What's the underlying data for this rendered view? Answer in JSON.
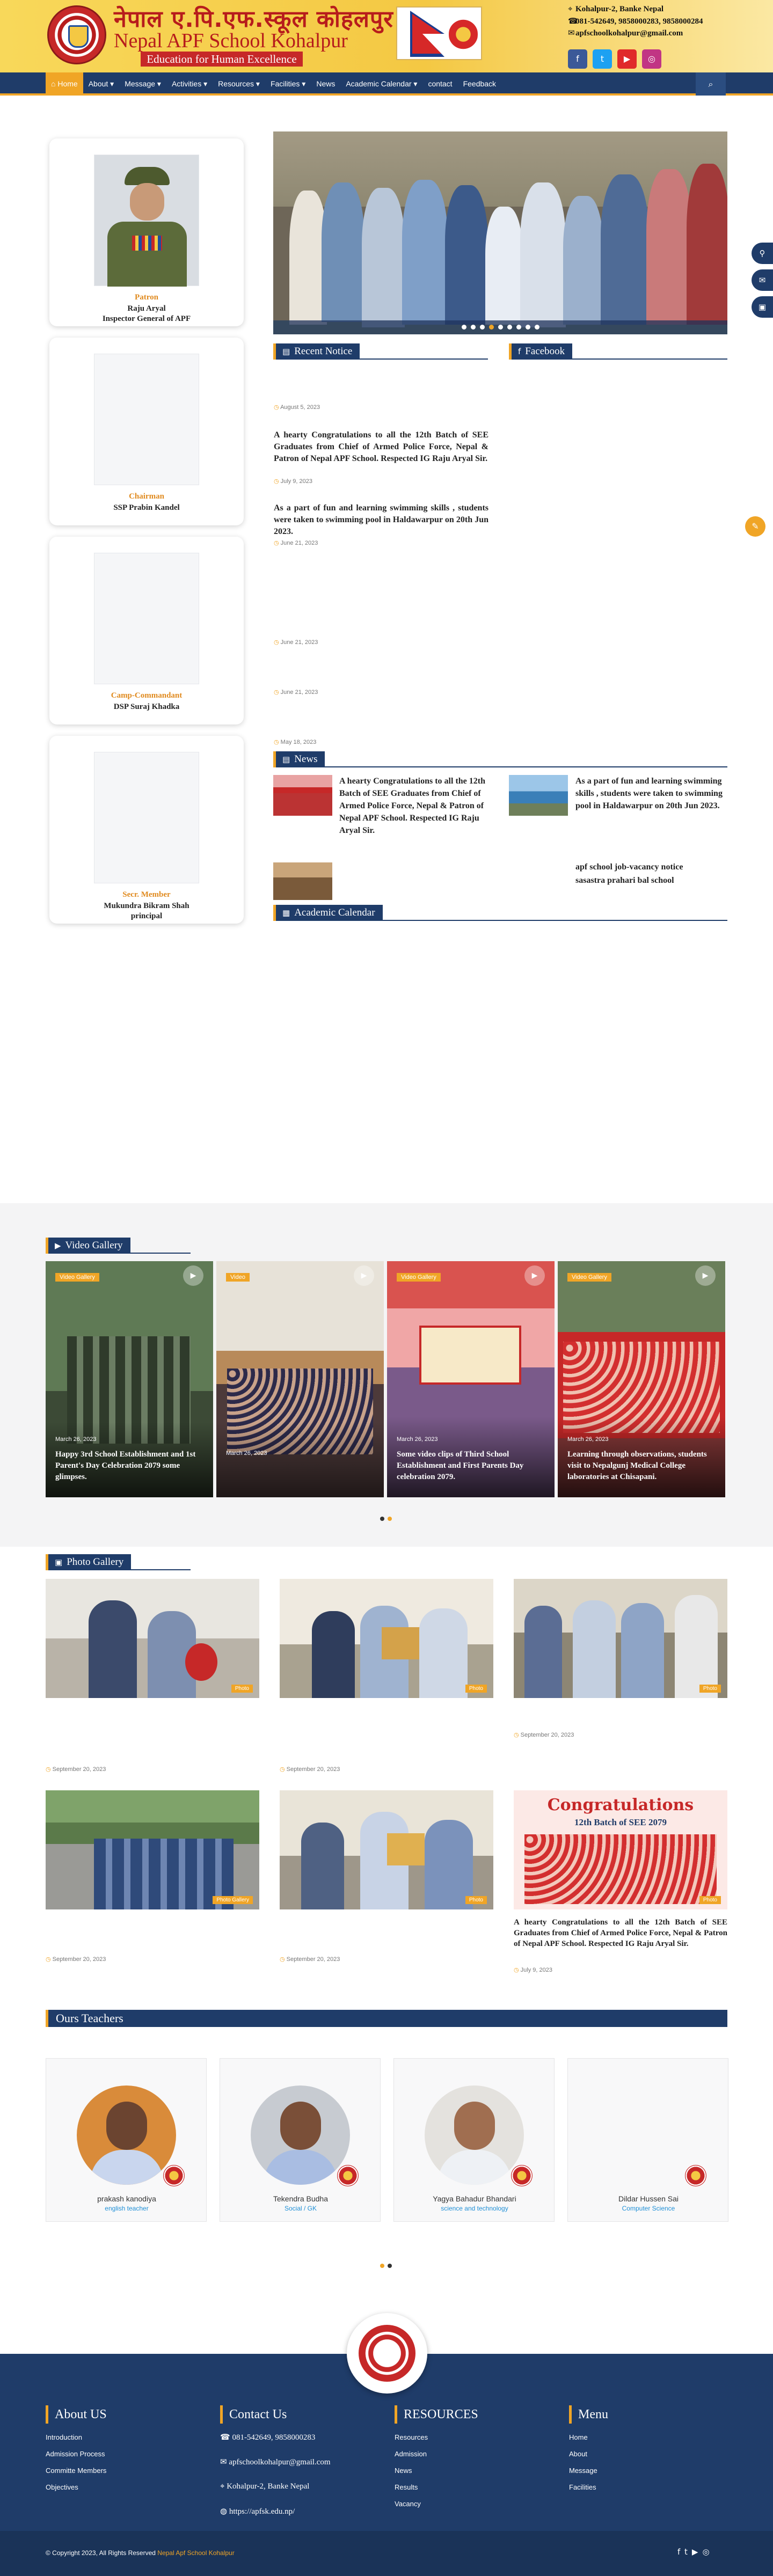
{
  "header": {
    "title_nepali": "नेपाल ए.पि.एफ.स्कूल कोहलपुर",
    "title_english": "Nepal APF School Kohalpur",
    "tagline": "Education for Human Excellence",
    "address": "Kohalpur-2, Banke Nepal",
    "phones": "081-542649, 9858000283, 9858000284",
    "email": "apfschoolkohalpur@gmail.com",
    "social": [
      "facebook-icon",
      "twitter-icon",
      "youtube-icon",
      "instagram-icon"
    ],
    "social_colors": [
      "#3b5998",
      "#1da1f2",
      "#e02a2a",
      "#c13584"
    ],
    "social_glyphs": [
      "f",
      "t",
      "▶",
      "◎"
    ]
  },
  "nav": {
    "items": [
      "⌂ Home",
      "About ▾",
      "Message ▾",
      "Activities ▾",
      "Resources ▾",
      "Facilities ▾",
      "News",
      "Academic Calendar ▾",
      "contact",
      "Feedback"
    ],
    "search_icon": "⌕"
  },
  "profiles": [
    {
      "rank": "Patron",
      "name": "Raju Aryal",
      "title": "Inspector General of APF"
    },
    {
      "rank": "Chairman",
      "name": "SSP Prabin Kandel",
      "title": ""
    },
    {
      "rank": "Camp-Commandant",
      "name": "DSP Suraj Khadka",
      "title": ""
    },
    {
      "rank": "Secr. Member",
      "name": "Mukundra Bikram Shah",
      "title": "principal"
    }
  ],
  "notice": {
    "heading": "Recent Notice",
    "facebook_heading": "Facebook",
    "items": [
      {
        "date": "August 5, 2023",
        "text": ""
      },
      {
        "date": "July 9, 2023",
        "text": "A hearty Congratulations to all the 12th Batch of SEE Graduates from Chief of Armed Police Force, Nepal & Patron of Nepal APF School. Respected IG Raju Aryal Sir."
      },
      {
        "date": "June 21, 2023",
        "text": "As a part of fun and learning swimming skills , students were taken to swimming pool in Haldawarpur on 20th Jun 2023."
      },
      {
        "date": "June 21, 2023",
        "text": ""
      },
      {
        "date": "June 21, 2023",
        "text": ""
      },
      {
        "date": "May 18, 2023",
        "text": ""
      }
    ]
  },
  "news": {
    "heading": "News",
    "items": [
      {
        "text": "A hearty Congratulations to all the 12th Batch of SEE Graduates from Chief of Armed Police Force, Nepal & Patron of Nepal APF School. Respected IG Raju Aryal Sir."
      },
      {
        "text": "As a part of fun and learning swimming skills , students were taken to swimming pool in Haldawarpur on 20th Jun 2023."
      },
      {
        "text": "apf school job-vacancy notice"
      },
      {
        "text": "sasastra prahari bal school"
      }
    ]
  },
  "calendar": {
    "heading": "Academic Calendar"
  },
  "video_gallery": {
    "heading": "Video Gallery",
    "items": [
      {
        "badge": "Video Gallery",
        "date": "March 26, 2023",
        "title": "Happy 3rd School Establishment and 1st Parent's Day Celebration 2079 some glimpses."
      },
      {
        "badge": "Video",
        "date": "March 26, 2023",
        "title": ""
      },
      {
        "badge": "Video Gallery",
        "date": "March 26, 2023",
        "title": "Some video clips of Third School Establishment and First Parents Day celebration 2079."
      },
      {
        "badge": "Video Gallery",
        "date": "March 26, 2023",
        "title": "Learning through observations, students visit to Nepalgunj Medical College laboratories at Chisapani."
      }
    ]
  },
  "photo_gallery": {
    "heading": "Photo Gallery",
    "items": [
      {
        "badge": "Photo",
        "date": "September 20, 2023",
        "caption": ""
      },
      {
        "badge": "Photo",
        "date": "September 20, 2023",
        "caption": ""
      },
      {
        "badge": "Photo",
        "date": "September 20, 2023",
        "caption": ""
      },
      {
        "badge": "Photo Gallery",
        "date": "September 20, 2023",
        "caption": ""
      },
      {
        "badge": "Photo",
        "date": "September 20, 2023",
        "caption": ""
      },
      {
        "badge": "Photo",
        "date": "July 9, 2023",
        "caption": "A hearty Congratulations to all the 12th Batch of SEE Graduates from Chief of Armed Police Force, Nepal & Patron of Nepal APF School. Respected IG Raju Aryal Sir."
      }
    ],
    "banner_text": "Congratulations",
    "banner_sub": "12th Batch of SEE 2079"
  },
  "teachers": {
    "heading": "Ours Teachers",
    "items": [
      {
        "name": "prakash kanodiya",
        "role": "english teacher"
      },
      {
        "name": "Tekendra Budha",
        "role": "Social / GK"
      },
      {
        "name": "Yagya Bahadur Bhandari",
        "role": "science and technology"
      },
      {
        "name": "Dildar Hussen Sai",
        "role": "Computer Science"
      }
    ]
  },
  "footer": {
    "about_heading": "About US",
    "about_links": [
      "Introduction",
      "Admission Process",
      "Committe Members",
      "Objectives"
    ],
    "contact_heading": "Contact Us",
    "contact_phone": "081-542649, 9858000283",
    "contact_email": "apfschoolkohalpur@gmail.com",
    "contact_address": "Kohalpur-2, Banke Nepal",
    "contact_web": "https://apfsk.edu.np/",
    "resources_heading": "RESOURCES",
    "resources_links": [
      "Resources",
      "Admission",
      "News",
      "Results",
      "Vacancy"
    ],
    "menu_heading": "Menu",
    "menu_links": [
      "Home",
      "About",
      "Message",
      "Facilities"
    ],
    "copyright_prefix": "© Copyright 2023, All Rights Reserved",
    "copyright_name": "Nepal Apf School Kohalpur"
  },
  "floating": [
    "⚲",
    "✉",
    "▣",
    "✎"
  ],
  "colors": {
    "navy": "#1f3c69",
    "accent": "#f0a526",
    "brand_red": "#b71c1c"
  }
}
